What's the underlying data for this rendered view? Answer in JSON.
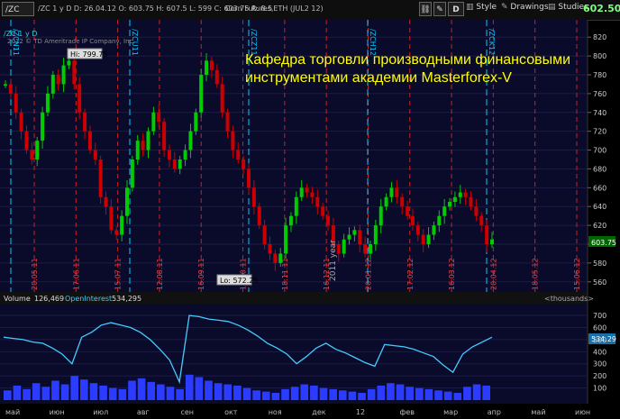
{
  "toolbar": {
    "symbol_field": "/ZC",
    "header_text": "/ZC 1 y D  D: 26.04.12  O: 603.75  H: 607.5  L: 599  C: 603.75  R: 8.5",
    "description": "Corn Futures,ETH (JUL2 12)",
    "period_button": "D",
    "style_label": "Style",
    "drawings_label": "Drawings",
    "studies_label": "Studies",
    "last_price": "602.50"
  },
  "chart": {
    "chart_title": "/ZC 1 y D",
    "copyright": "2012 © TD Ameritrade IP Company, Inc.",
    "banner_line1": "Кафедра торговли производными финансовыми",
    "banner_line2": "инструментами академии Masterforex-V",
    "hi_label": "Hi: 799.75",
    "lo_label": "Lo: 572.25",
    "year_label": "2011 year",
    "last_price_tag": "603.75",
    "volume_label": "Volume",
    "volume_value": "126,469",
    "oi_label": "OpenInterest",
    "oi_value": "534,295",
    "oi_tag": "534.29",
    "thousands_label": "<thousands>",
    "colors": {
      "background": "#000000",
      "chart_panel": "#0a0a2a",
      "bull_candle": "#00cc00",
      "bear_candle": "#cc0000",
      "expiry_line": "#00ccff",
      "event_line": "#cc2222",
      "oi_line": "#44ccff",
      "banner_text": "#ffff00"
    }
  },
  "chart_data": {
    "type": "candlestick",
    "title": "/ZC 1 y D",
    "y_ticks": [
      "820",
      "800",
      "780",
      "760",
      "740",
      "720",
      "700",
      "680",
      "660",
      "640",
      "620",
      "600",
      "580",
      "560"
    ],
    "ylim": [
      555,
      825
    ],
    "volume_ticks": [
      "700",
      "600",
      "500",
      "400",
      "300",
      "200",
      "100"
    ],
    "volume_ylim": [
      0,
      760
    ],
    "x_month_labels": [
      "май",
      "июн",
      "июл",
      "авг",
      "сен",
      "окт",
      "ноя",
      "дек",
      "12",
      "фев",
      "мар",
      "апр",
      "май",
      "июн"
    ],
    "expiry_labels": [
      "/ZCN11",
      "/ZCU11",
      "/ZCZ11",
      "/ZCH12",
      "/ZCK12"
    ],
    "event_dates": [
      "20.05.11",
      "17.06.11",
      "15.07.11",
      "12.08.11",
      "16.09.11",
      "14.10.11",
      "18.11.11",
      "16.12.11",
      "20.01.12",
      "17.02.12",
      "16.03.12",
      "20.04.12",
      "18.05.12",
      "15.06.12"
    ],
    "close_series": [
      770,
      760,
      740,
      720,
      700,
      690,
      710,
      740,
      760,
      780,
      770,
      790,
      795,
      770,
      740,
      720,
      700,
      690,
      650,
      640,
      615,
      610,
      630,
      660,
      690,
      710,
      700,
      720,
      740,
      730,
      700,
      690,
      680,
      690,
      700,
      720,
      740,
      780,
      795,
      785,
      770,
      740,
      720,
      700,
      690,
      680,
      660,
      640,
      620,
      600,
      590,
      580,
      590,
      620,
      630,
      650,
      660,
      655,
      650,
      640,
      630,
      620,
      600,
      590,
      605,
      610,
      615,
      600,
      590,
      600,
      620,
      640,
      650,
      660,
      650,
      640,
      630,
      620,
      610,
      600,
      610,
      620,
      630,
      640,
      645,
      650,
      655,
      650,
      640,
      630,
      620,
      600,
      605
    ],
    "open_interest": [
      520,
      510,
      500,
      480,
      470,
      430,
      380,
      300,
      520,
      560,
      620,
      640,
      620,
      600,
      560,
      500,
      420,
      330,
      150,
      700,
      690,
      670,
      660,
      650,
      620,
      580,
      530,
      470,
      430,
      380,
      300,
      360,
      430,
      470,
      420,
      390,
      350,
      310,
      280,
      460,
      450,
      440,
      420,
      390,
      360,
      290,
      230,
      380,
      440,
      480,
      520
    ],
    "volume_bars_approx": [
      80,
      120,
      90,
      140,
      110,
      160,
      130,
      200,
      170,
      140,
      120,
      100,
      90,
      160,
      180,
      150,
      130,
      110,
      90,
      210,
      190,
      160,
      140,
      130,
      120,
      100,
      80,
      70,
      60,
      90,
      110,
      130,
      120,
      100,
      90,
      80,
      70,
      60,
      90,
      120,
      140,
      130,
      110,
      100,
      90,
      80,
      70,
      60,
      110,
      130,
      120
    ]
  }
}
